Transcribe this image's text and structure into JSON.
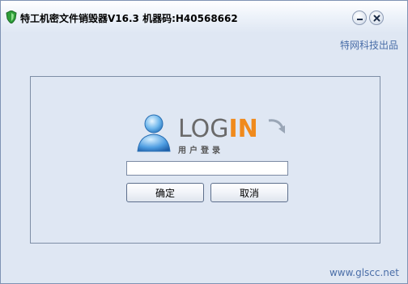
{
  "window": {
    "title": "特工机密文件销毁器V16.3 机器码:H40568662"
  },
  "header": {
    "brand": "特网科技出品"
  },
  "login": {
    "logo_text": "LOGIN",
    "subtitle": "用户登录",
    "password_value": "",
    "ok_label": "确定",
    "cancel_label": "取消"
  },
  "footer": {
    "url": "www.glscc.net"
  },
  "icons": {
    "app": "shield-icon",
    "minimize": "minimize-icon",
    "close": "close-icon",
    "user": "user-icon"
  },
  "colors": {
    "accent": "#4a6ea8",
    "login_orange": "#f08a1c",
    "login_gray": "#6a6a6a"
  }
}
